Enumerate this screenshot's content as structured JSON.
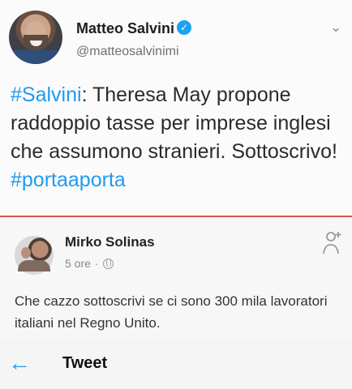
{
  "tweet": {
    "author_name": "Matteo Salvini",
    "author_handle": "@matteosalvinimi",
    "verified_icon": "verified-check-icon",
    "more_icon": "chevron-down-icon",
    "text_prefix_hashtag": "#Salvini",
    "text_body": ": Theresa May propone raddoppio tasse per imprese inglesi che assumono stranieri. Sottoscrivo! ",
    "text_suffix_hashtag": "#portaaporta",
    "hashtag_color": "#1d9bf0"
  },
  "reply": {
    "author_name": "Mirko Solinas",
    "time": "5 ore",
    "separator": "·",
    "audience_icon": "globe-icon",
    "add_icon": "add-person-icon",
    "text": "Che cazzo sottoscrivi se ci sono 300 mila lavoratori italiani nel Regno Unito."
  },
  "toolbar": {
    "back_icon": "back-arrow-icon",
    "title": "Tweet"
  }
}
